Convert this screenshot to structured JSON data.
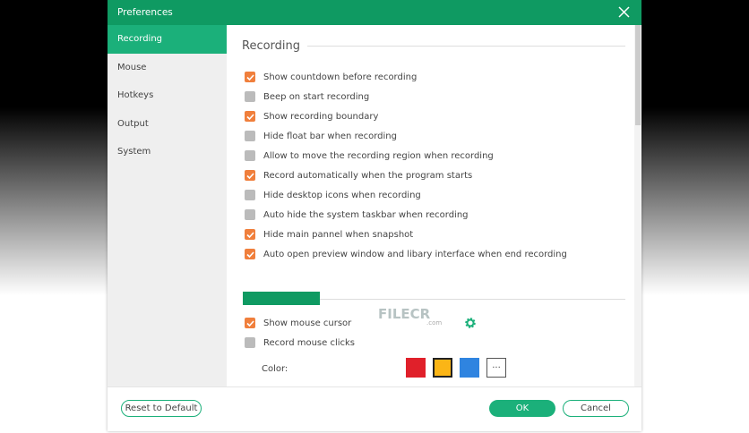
{
  "window": {
    "title": "Preferences"
  },
  "sidebar": {
    "items": [
      {
        "label": "Recording",
        "active": true
      },
      {
        "label": "Mouse"
      },
      {
        "label": "Hotkeys"
      },
      {
        "label": "Output"
      },
      {
        "label": "System"
      }
    ]
  },
  "recording": {
    "heading": "Recording",
    "options": [
      {
        "label": "Show countdown before recording",
        "checked": true
      },
      {
        "label": "Beep on start recording",
        "checked": false
      },
      {
        "label": "Show recording boundary",
        "checked": true
      },
      {
        "label": "Hide float bar when recording",
        "checked": false
      },
      {
        "label": "Allow to move the recording region when recording",
        "checked": false
      },
      {
        "label": "Record automatically when the program starts",
        "checked": true
      },
      {
        "label": "Hide desktop icons when recording",
        "checked": false
      },
      {
        "label": "Auto hide the system taskbar when recording",
        "checked": false
      },
      {
        "label": "Hide main pannel when snapshot",
        "checked": true
      },
      {
        "label": "Auto open preview window and libary interface when end recording",
        "checked": true
      }
    ]
  },
  "mouse": {
    "options": [
      {
        "label": "Show mouse cursor",
        "checked": true
      },
      {
        "label": "Record mouse clicks",
        "checked": false
      }
    ],
    "color_label": "Color:",
    "colors": [
      "#e0202a",
      "#fbb516",
      "#2f84e0"
    ],
    "selected_color": "#fbb516",
    "more": "···"
  },
  "footer": {
    "reset": "Reset to Default",
    "ok": "OK",
    "cancel": "Cancel"
  },
  "watermark": {
    "text": "FILECR",
    "sub": ".com"
  },
  "colors": {
    "titlebar": "#0f9a62",
    "accent": "#1bb07a",
    "checkbox": "#f07f3c"
  }
}
